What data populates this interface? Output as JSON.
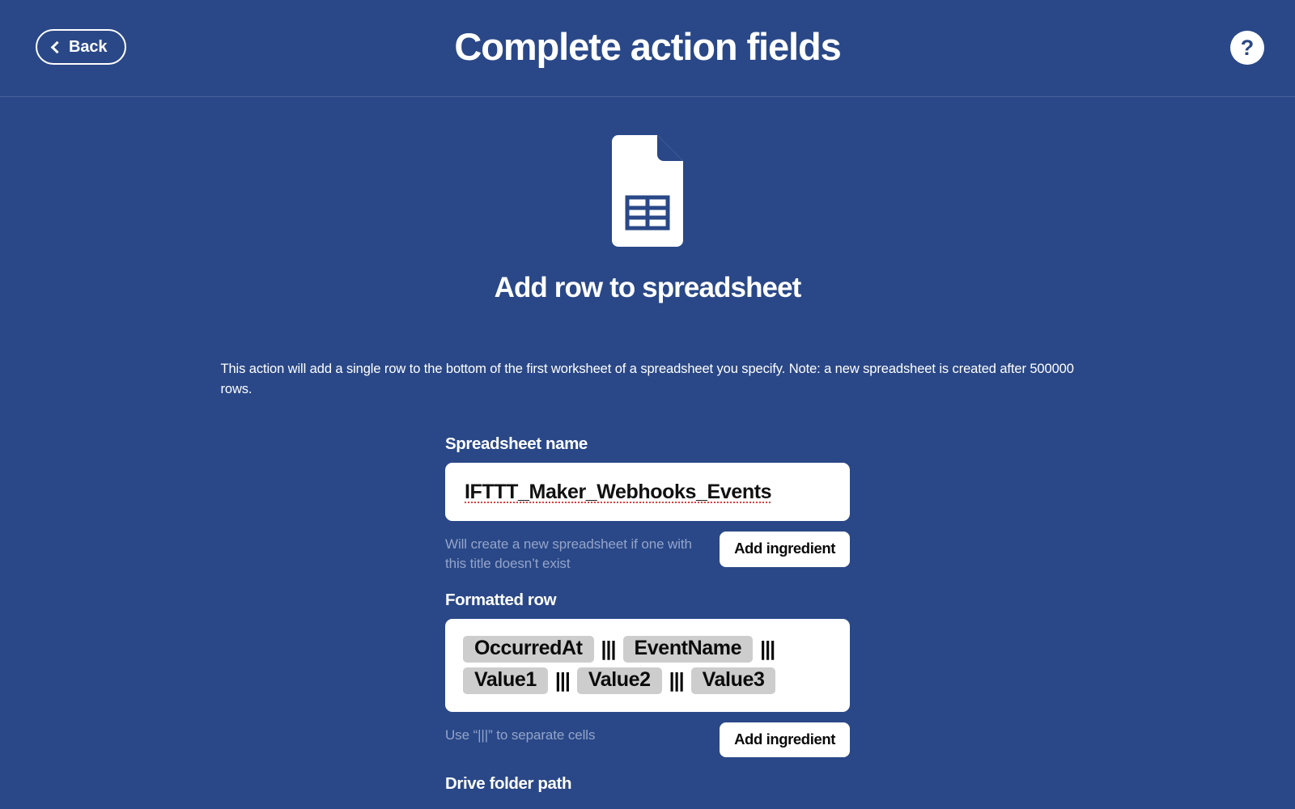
{
  "theme": {
    "background": "#2a4887",
    "surface": "#ffffff",
    "text_on_blue": "#ffffff",
    "helper_text": "#93a4ca",
    "chip_background": "#cdcdcd",
    "spellcheck_underline": "#e23b3b",
    "divider": "#4a6099"
  },
  "header": {
    "back_label": "Back",
    "back_icon": "chevron-left-icon",
    "title": "Complete action fields",
    "help_icon": "question-mark-icon",
    "help_label": "?"
  },
  "main": {
    "service_icon": "spreadsheet-document-icon",
    "action_title": "Add row to spreadsheet",
    "description": "This action will add a single row to the bottom of the first worksheet of a spreadsheet you specify. Note: a new spreadsheet is created after 500000 rows."
  },
  "fields": [
    {
      "label": "Spreadsheet name",
      "value": "IFTTT_Maker_Webhooks_Events",
      "helper": "Will create a new spreadsheet if one with this title doesn’t exist",
      "add_ingredient_label": "Add ingredient"
    },
    {
      "label": "Formatted row",
      "helper": "Use “|||” to separate cells",
      "add_ingredient_label": "Add ingredient",
      "separator": "|||",
      "ingredients": [
        "OccurredAt",
        "EventName",
        "Value1",
        "Value2",
        "Value3"
      ]
    },
    {
      "label": "Drive folder path"
    }
  ]
}
